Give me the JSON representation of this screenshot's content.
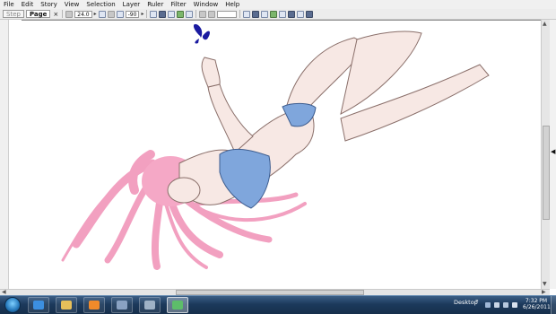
{
  "menu": [
    "File",
    "Edit",
    "Story",
    "View",
    "Selection",
    "Layer",
    "Ruler",
    "Filter",
    "Window",
    "Help"
  ],
  "toolbar": {
    "tabs": [
      {
        "label": "Step",
        "active": false
      },
      {
        "label": "Page",
        "active": true
      }
    ],
    "close_glyph": "×",
    "brush_size": "24.0",
    "rotation": "-90",
    "arrow_glyph": "▸"
  },
  "scroll": {
    "up": "▲",
    "down": "▼",
    "left": "◀",
    "right": "▶"
  },
  "side_arrow": "◀",
  "taskbar": {
    "pinned_apps": [
      {
        "icon": "internet-explorer-icon",
        "color": "#3c8fe0"
      },
      {
        "icon": "folder-icon",
        "color": "#e7c05a"
      },
      {
        "icon": "media-player-icon",
        "color": "#f08a2a"
      },
      {
        "icon": "window-icon",
        "color": "#8aa2c2"
      },
      {
        "icon": "calculator-icon",
        "color": "#9fb2c6"
      },
      {
        "icon": "chat-icon",
        "color": "#5dbd6a"
      }
    ],
    "desktop_label": "Desktop",
    "chevron": "»",
    "time": "7:32 PM",
    "date": "6/26/2011"
  },
  "colors": {
    "hair": "#f2a0c0",
    "swimsuit": "#7fa6dc",
    "skin": "#f7e8e4",
    "butterfly": "#1a1aa0"
  }
}
